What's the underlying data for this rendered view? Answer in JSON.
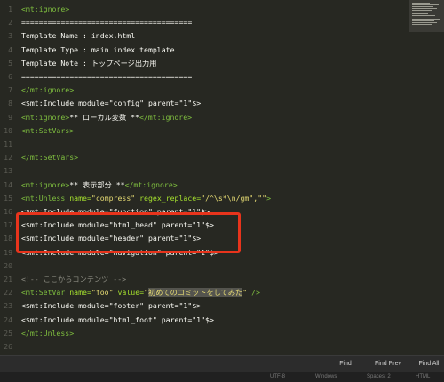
{
  "editor": {
    "lines": [
      {
        "num": "1",
        "segs": [
          {
            "t": "<mt:ignore>",
            "c": "tag"
          }
        ]
      },
      {
        "num": "2",
        "segs": [
          {
            "t": "=======================================",
            "c": ""
          }
        ]
      },
      {
        "num": "3",
        "segs": [
          {
            "t": "Template Name : index.html",
            "c": ""
          }
        ]
      },
      {
        "num": "4",
        "segs": [
          {
            "t": "Template Type : main index template",
            "c": ""
          }
        ]
      },
      {
        "num": "5",
        "segs": [
          {
            "t": "Template Note : トップページ出力用",
            "c": ""
          }
        ]
      },
      {
        "num": "6",
        "segs": [
          {
            "t": "=======================================",
            "c": ""
          }
        ]
      },
      {
        "num": "7",
        "segs": [
          {
            "t": "</mt:ignore>",
            "c": "tag"
          }
        ]
      },
      {
        "num": "8",
        "segs": [
          {
            "t": "<$mt:Include ",
            "c": ""
          },
          {
            "t": "module=",
            "c": ""
          },
          {
            "t": "\"config\"",
            "c": ""
          },
          {
            "t": " parent=",
            "c": ""
          },
          {
            "t": "\"1\"",
            "c": ""
          },
          {
            "t": "$>",
            "c": ""
          }
        ]
      },
      {
        "num": "9",
        "segs": [
          {
            "t": "<mt:ignore>",
            "c": "tag"
          },
          {
            "t": "** ローカル変数 **",
            "c": ""
          },
          {
            "t": "</mt:ignore>",
            "c": "tag"
          }
        ]
      },
      {
        "num": "10",
        "segs": [
          {
            "t": "<mt:SetVars>",
            "c": "tag"
          }
        ]
      },
      {
        "num": "11",
        "segs": []
      },
      {
        "num": "12",
        "segs": [
          {
            "t": "</mt:SetVars>",
            "c": "tag"
          }
        ]
      },
      {
        "num": "13",
        "segs": []
      },
      {
        "num": "14",
        "segs": [
          {
            "t": "<mt:ignore>",
            "c": "tag"
          },
          {
            "t": "** 表示部分 **",
            "c": ""
          },
          {
            "t": "</mt:ignore>",
            "c": "tag"
          }
        ]
      },
      {
        "num": "15",
        "segs": [
          {
            "t": "<mt:Unless ",
            "c": "tag"
          },
          {
            "t": "name=",
            "c": "attr"
          },
          {
            "t": "\"compress\"",
            "c": "str"
          },
          {
            "t": " regex_replace=",
            "c": "attr"
          },
          {
            "t": "\"/^\\s*\\n/gm\",\"\"",
            "c": "str"
          },
          {
            "t": ">",
            "c": "tag"
          }
        ]
      },
      {
        "num": "16",
        "segs": [
          {
            "t": "<$mt:Include module=\"function\" parent=\"1\"$>",
            "c": ""
          }
        ]
      },
      {
        "num": "17",
        "segs": [
          {
            "t": "<$mt:Include module=\"html_head\" parent=\"1\"$>",
            "c": ""
          }
        ]
      },
      {
        "num": "18",
        "segs": [
          {
            "t": "<$mt:Include module=\"header\" parent=\"1\"$>",
            "c": ""
          }
        ]
      },
      {
        "num": "19",
        "segs": [
          {
            "t": "<$mt:Include module=\"navigation\" parent=\"1\"$>",
            "c": ""
          }
        ]
      },
      {
        "num": "20",
        "segs": []
      },
      {
        "num": "21",
        "segs": [
          {
            "t": "<!-- ここからコンテンツ -->",
            "c": "cmt"
          }
        ]
      },
      {
        "num": "22",
        "segs": [
          {
            "t": "<mt:SetVar ",
            "c": "tag"
          },
          {
            "t": "name=",
            "c": "attr"
          },
          {
            "t": "\"foo\"",
            "c": "str"
          },
          {
            "t": " value=",
            "c": "attr"
          },
          {
            "t": "\"",
            "c": "str"
          },
          {
            "t": "初めてのコミットをしてみた",
            "c": "str sel"
          },
          {
            "t": "\"",
            "c": "str"
          },
          {
            "t": " />",
            "c": "tag"
          }
        ]
      },
      {
        "num": "23",
        "segs": [
          {
            "t": "<$mt:Include module=\"footer\" parent=\"1\"$>",
            "c": ""
          }
        ]
      },
      {
        "num": "24",
        "segs": [
          {
            "t": "<$mt:Include module=\"html_foot\" parent=\"1\"$>",
            "c": ""
          }
        ]
      },
      {
        "num": "25",
        "segs": [
          {
            "t": "</mt:Unless>",
            "c": "tag"
          }
        ]
      },
      {
        "num": "26",
        "segs": []
      }
    ]
  },
  "findbar": {
    "find_label": "Find",
    "find_prev_label": "Find Prev",
    "find_all_label": "Find All"
  },
  "status": {
    "encoding": "UTF-8",
    "line_endings": "Windows",
    "indent": "Spaces: 2",
    "syntax": "HTML"
  }
}
